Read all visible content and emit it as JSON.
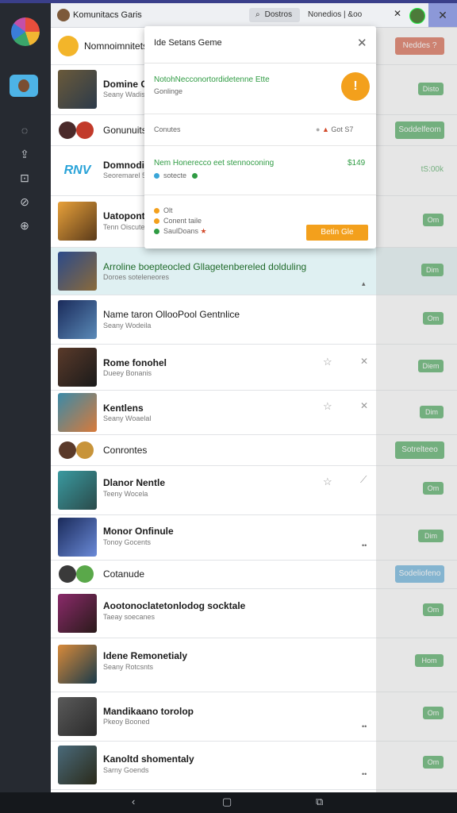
{
  "titlebar": {
    "title": "Komunitacs Garis",
    "search_label": "Dostros",
    "right_text": "Nonedios | &oo",
    "close_glyph": "✕",
    "x_glyph": "✕"
  },
  "rail": {
    "icons": [
      "◌",
      "⇪",
      "⊡",
      "⊘",
      "⊕"
    ]
  },
  "header_row": {
    "title": "Nomnoimnitets",
    "button": "Neddes ?"
  },
  "rows": [
    {
      "title": "Domine Ok",
      "subtitle": "Seany Wadiste",
      "pill": "Disto"
    },
    {
      "title": "Gonunuits",
      "subtitle": "",
      "button": "Soddelfeom"
    },
    {
      "title": "Domnodii",
      "subtitle": "Seoremarel 5.1",
      "logo": "RNV",
      "right": "tS:00k"
    },
    {
      "title": "Uatoponte",
      "subtitle": "Tenn Oiscutes",
      "pill": "Om"
    },
    {
      "title": "Arroline boepteocled Gllagetenbereled dolduling",
      "subtitle": "Doroes soteleneores",
      "pill": "Dim"
    },
    {
      "title": "Name taron OllooPool Gentnlice",
      "subtitle": "Seany Wodeila",
      "pill": "Om"
    },
    {
      "title": "Rome fonohel",
      "subtitle": "Dueey Bonanis",
      "pill": "Diem"
    },
    {
      "title": "Kentlens",
      "subtitle": "Seany Woaelal",
      "pill": "Dim"
    },
    {
      "title": "Conrontes",
      "subtitle": "",
      "button": "Sotrelteeo"
    },
    {
      "title": "Dlanor Nentle",
      "subtitle": "Teeny Wocela",
      "pill": "Om"
    },
    {
      "title": "Monor Onfinule",
      "subtitle": "Tonoy Gocents",
      "pill": "Dim"
    },
    {
      "title": "Cotanude",
      "subtitle": "",
      "button": "Sodeliofeno"
    },
    {
      "title": "Aootonoclatetonlodog socktale",
      "subtitle": "Taeay soecanes",
      "pill": "Om"
    },
    {
      "title": "Idene Remonetialy",
      "subtitle": "Seany Rotcsnts",
      "pill": "Hom"
    },
    {
      "title": "Mandikaano torolop",
      "subtitle": "Pkeoy Booned",
      "pill": "Om"
    },
    {
      "title": "Kanoltd shomentaly",
      "subtitle": "Sarny Goends",
      "pill": "Om"
    }
  ],
  "popup": {
    "title": "Ide Setans Geme",
    "close": "✕",
    "s1_title": "NotohNecconortordidetenne Ette",
    "s1_sub": "Gonlinge",
    "badge": "!",
    "s2_left": "Conutes",
    "s2_right": "Got S7",
    "s3_title": "Nem Honerecco eet stennoconing",
    "s3_price": "$149",
    "s3_sub": "sotecte",
    "list": [
      "Olt",
      "Conent taile",
      "SaulDoans"
    ],
    "button": "Betin Gle"
  },
  "navbar": {
    "back": "‹",
    "home": "▢",
    "recent": "⧉"
  },
  "colors": {
    "accent_green": "#2f9b43",
    "accent_orange": "#f3a01c",
    "accent_red": "#d24a2a",
    "accent_blue": "#4da4d8"
  }
}
